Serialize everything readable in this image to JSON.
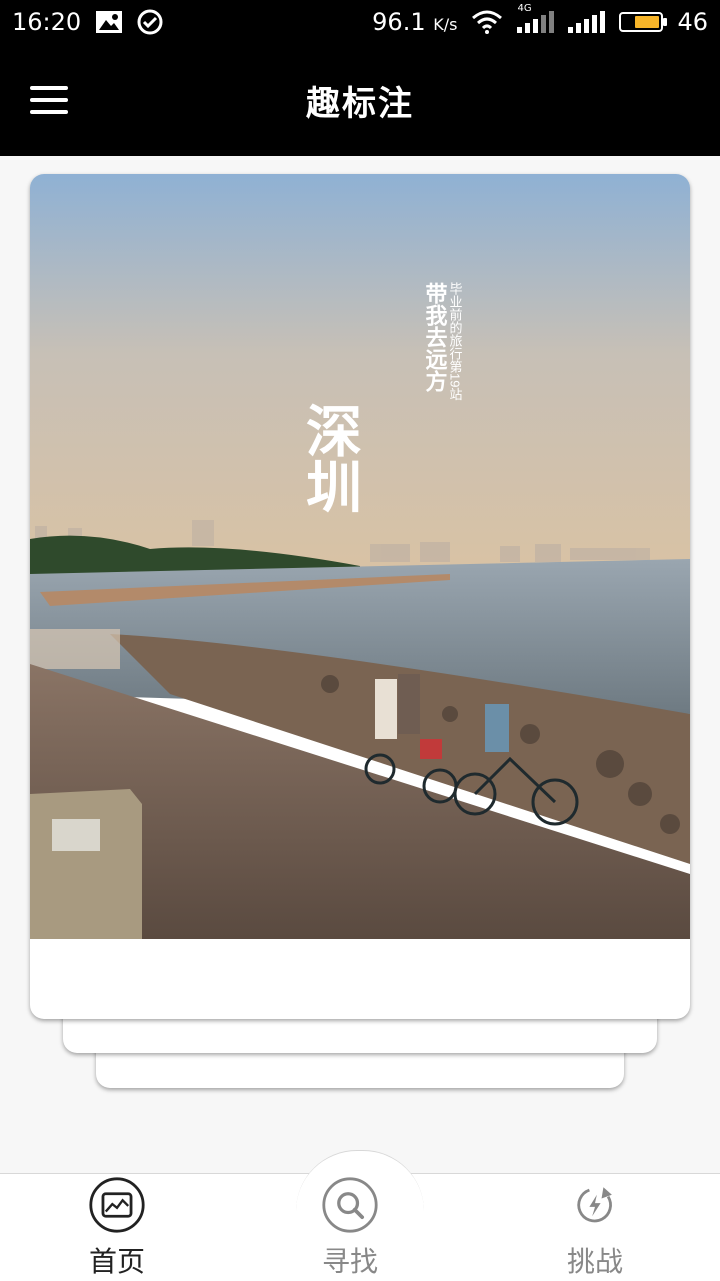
{
  "status_bar": {
    "time": "16:20",
    "speed": "96.1",
    "speed_unit": "K/s",
    "network": "4G",
    "battery": "46",
    "icons": [
      "image-icon",
      "check-circle-icon",
      "wifi-icon",
      "signal-icon",
      "battery-icon"
    ]
  },
  "app_bar": {
    "title": "趣标注",
    "menu_icon": "hamburger-menu-icon"
  },
  "card": {
    "poster_big": "深圳",
    "poster_line1": "带我去远方",
    "poster_line2": "毕业前的旅行第19站"
  },
  "bottom_nav": {
    "items": [
      {
        "label": "首页",
        "icon": "picture-chart-icon",
        "active": true
      },
      {
        "label": "寻找",
        "icon": "search-icon",
        "active": false
      },
      {
        "label": "挑战",
        "icon": "lightning-refresh-icon",
        "active": false
      }
    ]
  },
  "colors": {
    "bar": "#000000",
    "background": "#f7f7f7",
    "active_nav": "#222222",
    "inactive_nav": "#888888",
    "battery_fill": "#f7b529"
  }
}
